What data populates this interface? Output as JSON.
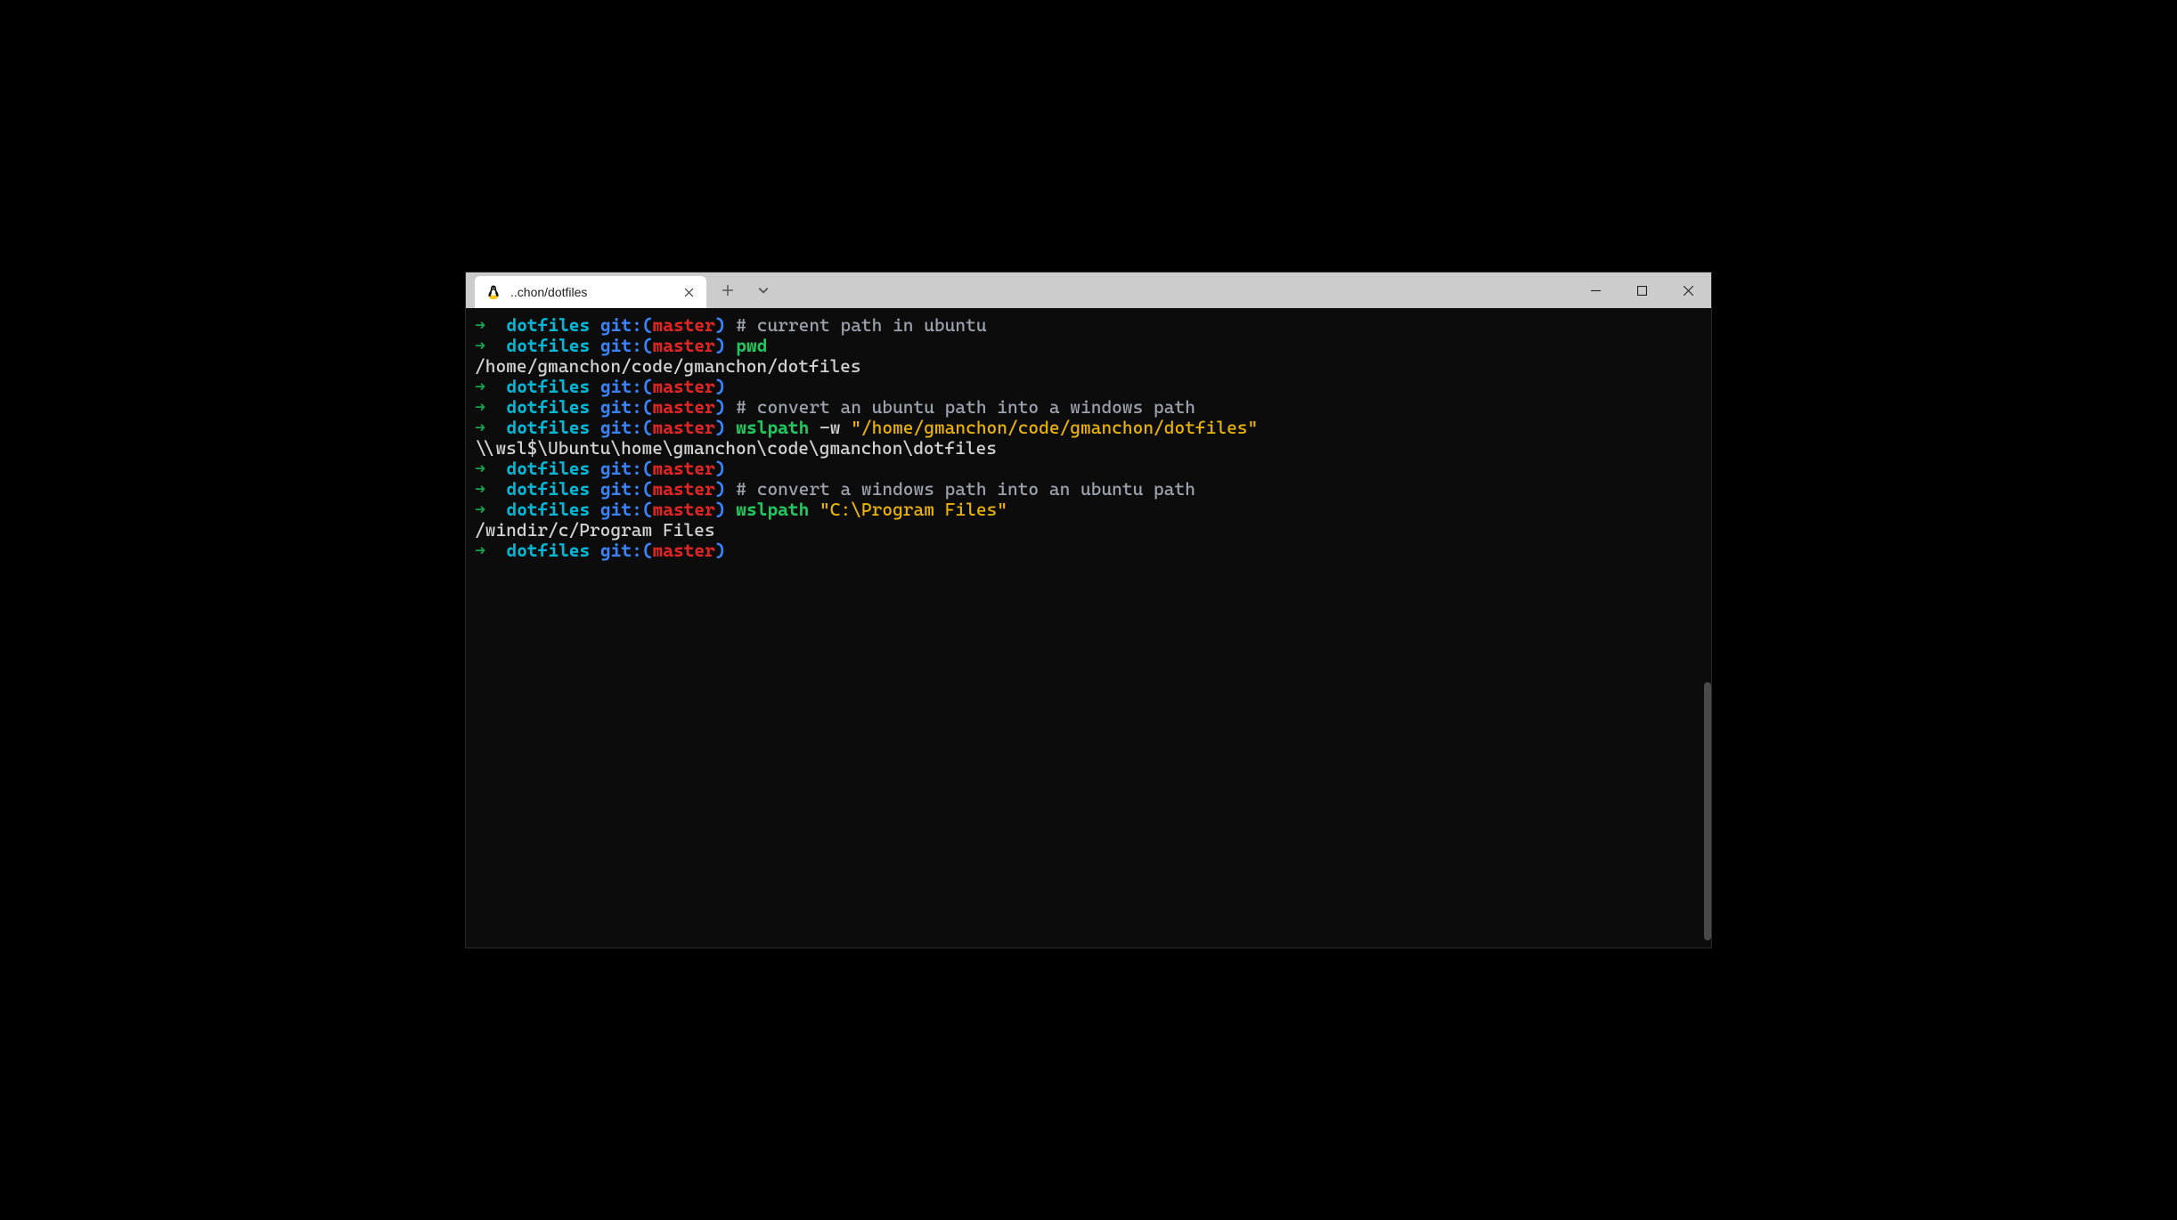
{
  "tab": {
    "title": "..chon/dotfiles"
  },
  "prompt": {
    "arrow": "➜",
    "dir": "dotfiles",
    "git_label": "git:(",
    "branch": "master",
    "git_close": ")"
  },
  "lines": [
    {
      "type": "prompt",
      "segments": [
        {
          "kind": "comment",
          "text": "# current path in ubuntu"
        }
      ]
    },
    {
      "type": "prompt",
      "segments": [
        {
          "kind": "cmd",
          "text": "pwd"
        }
      ]
    },
    {
      "type": "output",
      "text": "/home/gmanchon/code/gmanchon/dotfiles"
    },
    {
      "type": "prompt",
      "segments": []
    },
    {
      "type": "prompt",
      "segments": [
        {
          "kind": "comment",
          "text": "# convert an ubuntu path into a windows path"
        }
      ]
    },
    {
      "type": "prompt",
      "segments": [
        {
          "kind": "cmd",
          "text": "wslpath"
        },
        {
          "kind": "flag",
          "text": " -w "
        },
        {
          "kind": "str",
          "text": "\"/home/gmanchon/code/gmanchon/dotfiles\""
        }
      ]
    },
    {
      "type": "output",
      "text": "\\\\wsl$\\Ubuntu\\home\\gmanchon\\code\\gmanchon\\dotfiles"
    },
    {
      "type": "prompt",
      "segments": []
    },
    {
      "type": "prompt",
      "segments": [
        {
          "kind": "comment",
          "text": "# convert a windows path into an ubuntu path"
        }
      ]
    },
    {
      "type": "prompt",
      "segments": [
        {
          "kind": "cmd",
          "text": "wslpath"
        },
        {
          "kind": "flag",
          "text": " "
        },
        {
          "kind": "str",
          "text": "\"C:\\Program Files\""
        }
      ]
    },
    {
      "type": "output",
      "text": "/windir/c/Program Files"
    },
    {
      "type": "prompt",
      "segments": []
    }
  ]
}
